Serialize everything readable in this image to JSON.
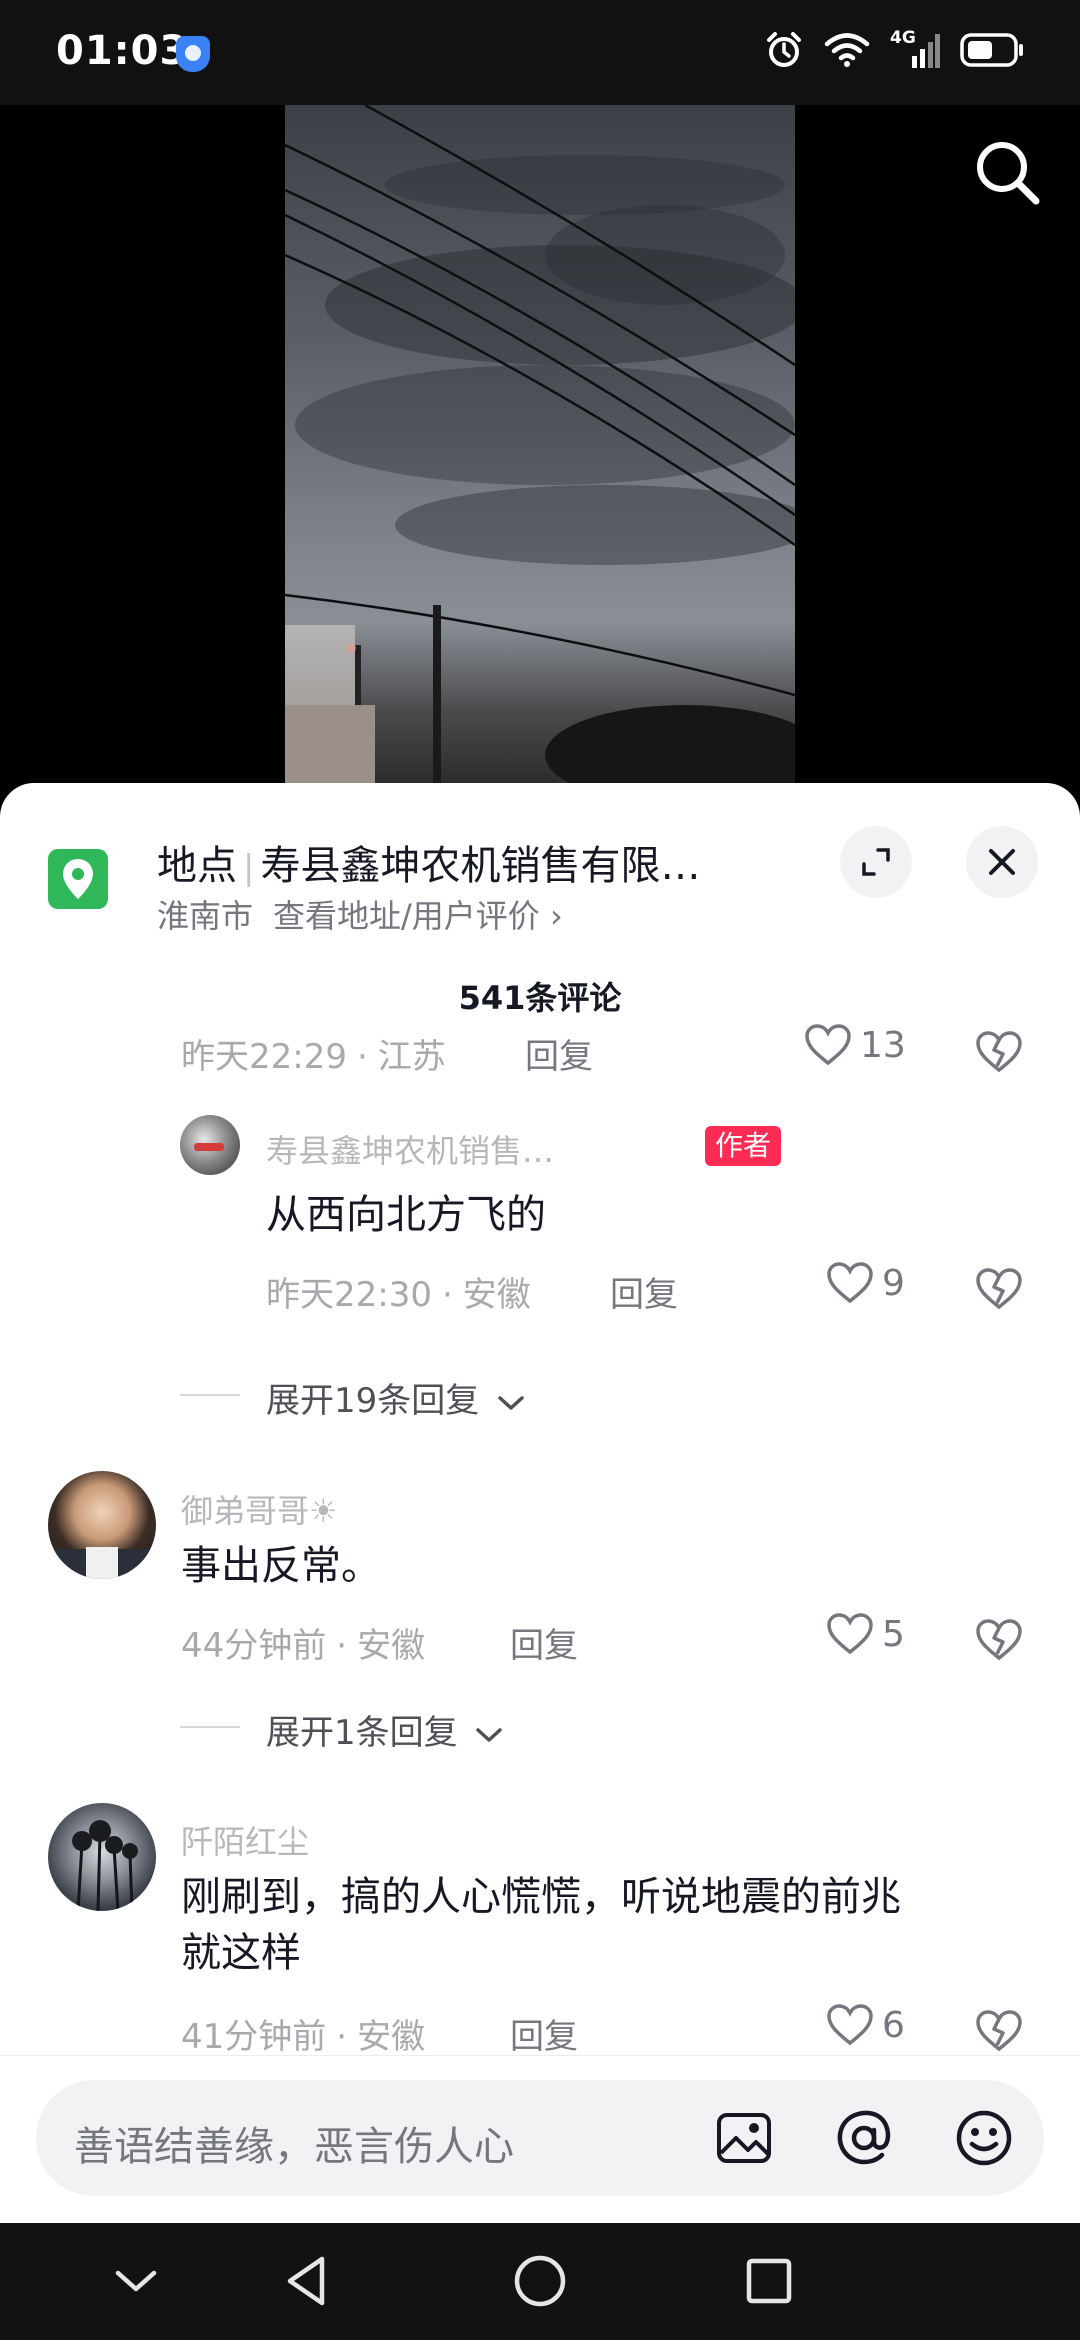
{
  "status_bar": {
    "time": "01:03",
    "network": "4G"
  },
  "location": {
    "label": "地点",
    "name": "寿县鑫坤农机销售有限…",
    "city": "淮南市",
    "link": "查看地址/用户评价 ›"
  },
  "comments_header": {
    "count_label": "541条评论"
  },
  "comments": [
    {
      "time": "昨天22:29",
      "region": "江苏",
      "reply": "回复",
      "likes": "13"
    },
    {
      "username": "寿县鑫坤农机销售…",
      "author_tag": "作者",
      "text": "从西向北方飞的",
      "time": "昨天22:30",
      "region": "安徽",
      "reply": "回复",
      "likes": "9",
      "expand": "展开19条回复"
    },
    {
      "username": "御弟哥哥☀",
      "text": "事出反常。",
      "time": "44分钟前",
      "region": "安徽",
      "reply": "回复",
      "likes": "5",
      "expand": "展开1条回复"
    },
    {
      "username": "阡陌红尘",
      "text_line1": "刚刷到，搞的人心慌慌，听说地震的前兆",
      "text_line2": "就这样",
      "time": "41分钟前",
      "region": "安徽",
      "reply": "回复",
      "likes": "6"
    }
  ],
  "input": {
    "placeholder": "善语结善缘，恶言伤人心"
  },
  "icons": {
    "search": "search-icon",
    "location": "location-pin-icon",
    "expand": "expand-icon",
    "close": "close-icon",
    "like": "heart-icon",
    "dislike": "broken-heart-icon",
    "image": "image-icon",
    "mention": "at-icon",
    "emoji": "emoji-icon"
  },
  "colors": {
    "accent": "#fe2c55",
    "location_green": "#2fb75a"
  }
}
